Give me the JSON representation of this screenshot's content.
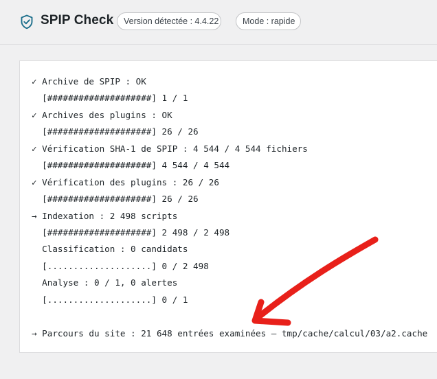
{
  "header": {
    "title": "SPIP Check",
    "version_badge": "Version détectée : 4.4.22",
    "mode_badge": "Mode : rapide",
    "icon": "shield-check-icon"
  },
  "log": {
    "lines": [
      "✓ Archive de SPIP : OK",
      "  [####################] 1 / 1",
      "✓ Archives des plugins : OK",
      "  [####################] 26 / 26",
      "✓ Vérification SHA-1 de SPIP : 4 544 / 4 544 fichiers",
      "  [####################] 4 544 / 4 544",
      "✓ Vérification des plugins : 26 / 26",
      "  [####################] 26 / 26",
      "→ Indexation : 2 498 scripts",
      "  [####################] 2 498 / 2 498",
      "  Classification : 0 candidats",
      "  [....................] 0 / 2 498",
      "  Analyse : 0 / 1, 0 alertes",
      "  [....................] 0 / 1",
      "",
      "→ Parcours du site : 21 648 entrées examinées — tmp/cache/calcul/03/a2.cache"
    ]
  },
  "annotation": {
    "color": "#e8201a"
  }
}
